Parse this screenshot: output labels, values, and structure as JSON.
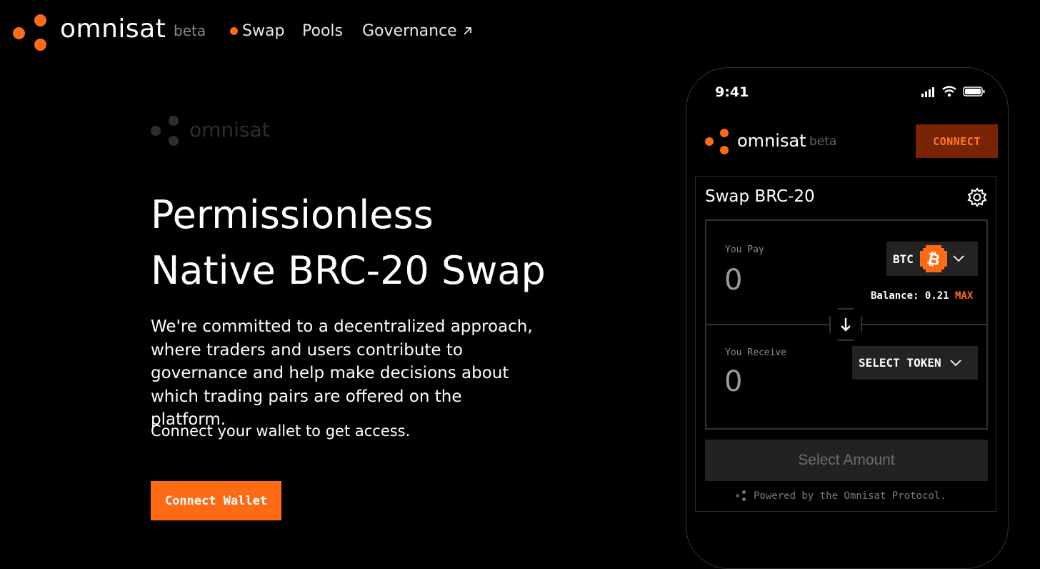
{
  "nav": {
    "brand": "omnisat",
    "beta": "beta",
    "links": [
      {
        "label": "Swap",
        "active": true
      },
      {
        "label": "Pools"
      },
      {
        "label": "Governance",
        "external_icon": "arrow-up-right-icon"
      }
    ]
  },
  "hero": {
    "brand": "omnisat",
    "title_line1": "Permissionless",
    "title_line2": "Native BRC-20 Swap",
    "description": "We're committed to a decentralized approach, where traders and users contribute to governance and help make decisions about which trading pairs are offered on the platform.",
    "connect_text": "Connect your wallet to get access.",
    "cta_label": "Connect Wallet"
  },
  "phone": {
    "status_time": "9:41",
    "status_icons": [
      "signal-icon",
      "wifi-icon",
      "battery-icon"
    ],
    "app_brand": "omnisat",
    "app_beta": "beta",
    "connect_label": "CONNECT",
    "swap_title": "Swap BRC-20",
    "pay": {
      "label": "You Pay",
      "amount": "0",
      "token": "BTC",
      "balance_label": "Balance: 0.21",
      "max_label": "MAX"
    },
    "receive": {
      "label": "You Receive",
      "amount": "0",
      "token_placeholder": "SELECT TOKEN"
    },
    "select_amount_label": "Select Amount",
    "powered_by": "Powered by the Omnisat Protocol."
  },
  "colors": {
    "accent": "#ff6a14",
    "background": "#000000",
    "connect_bg": "#7a2406"
  }
}
